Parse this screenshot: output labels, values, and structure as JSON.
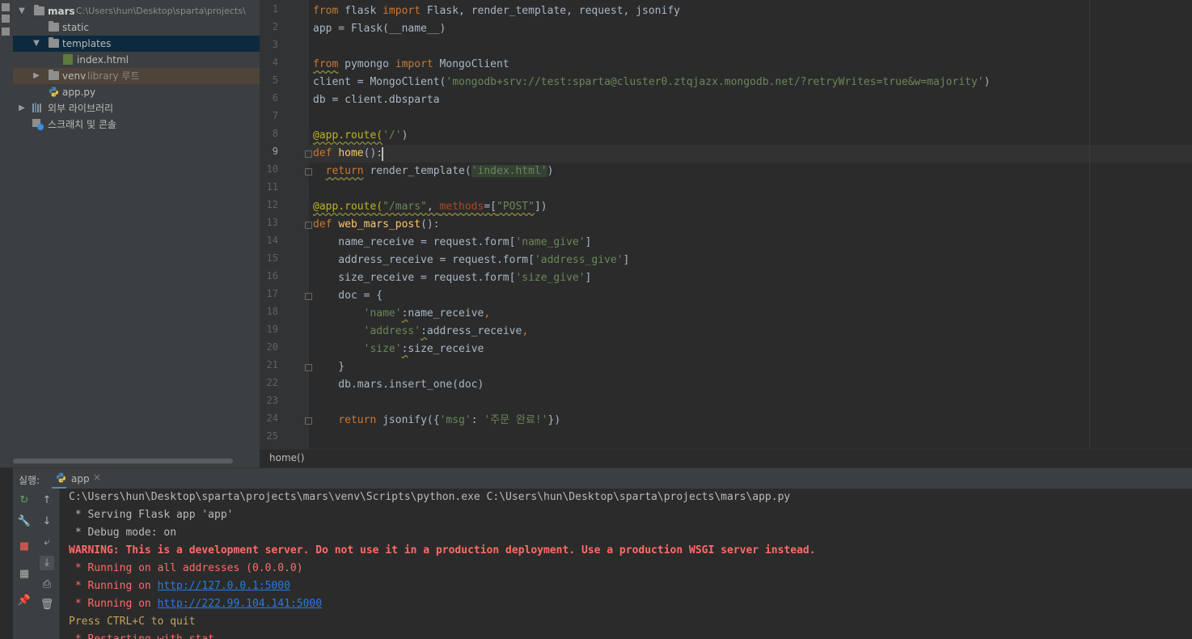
{
  "project": {
    "root_name": "mars",
    "root_path": "C:\\Users\\hun\\Desktop\\sparta\\projects\\",
    "items": [
      {
        "label": "static"
      },
      {
        "label": "templates"
      },
      {
        "label": "index.html"
      },
      {
        "label": "venv",
        "sub": "library 루트"
      },
      {
        "label": "app.py"
      },
      {
        "label": "외부 라이브러리"
      },
      {
        "label": "스크래치 및 콘솔"
      }
    ]
  },
  "editor": {
    "current_line": 9,
    "lines": [
      {
        "n": "1"
      },
      {
        "n": "2"
      },
      {
        "n": "3"
      },
      {
        "n": "4"
      },
      {
        "n": "5"
      },
      {
        "n": "6"
      },
      {
        "n": "7"
      },
      {
        "n": "8"
      },
      {
        "n": "9"
      },
      {
        "n": "10"
      },
      {
        "n": "11"
      },
      {
        "n": "12"
      },
      {
        "n": "13"
      },
      {
        "n": "14"
      },
      {
        "n": "15"
      },
      {
        "n": "16"
      },
      {
        "n": "17"
      },
      {
        "n": "18"
      },
      {
        "n": "19"
      },
      {
        "n": "20"
      },
      {
        "n": "21"
      },
      {
        "n": "22"
      },
      {
        "n": "23"
      },
      {
        "n": "24"
      },
      {
        "n": "25"
      }
    ],
    "code": {
      "l1": {
        "a": "from",
        "b": " flask ",
        "c": "import",
        "d": " Flask, render_template, request, jsonify"
      },
      "l2": "app = Flask(__name__)",
      "l4": {
        "a": "from",
        "b": " pymongo ",
        "c": "import",
        "d": " MongoClient"
      },
      "l5": {
        "a": "client = MongoClient(",
        "b": "'mongodb+srv://test:sparta@cluster0.ztqjazx.mongodb.net/?retryWrites=true&w=majority'",
        "c": ")"
      },
      "l6": "db = client.dbsparta",
      "l8": {
        "a": "@app.route(",
        "b": "'/'",
        "c": ")"
      },
      "l9": {
        "a": "def",
        "b": " ",
        "c": "home",
        "d": "():"
      },
      "l10": {
        "a": "return",
        "b": " render_template(",
        "c": "'index.html'",
        "d": ")"
      },
      "l12": {
        "a": "@app.route(",
        "b": "\"/mars\"",
        "c": ", ",
        "d": "methods",
        "e": "=[",
        "f": "\"POST\"",
        "g": "])"
      },
      "l13": {
        "a": "def",
        "b": " ",
        "c": "web_mars_post",
        "d": "():"
      },
      "l14": {
        "a": "    name_receive = request.form[",
        "b": "'name_give'",
        "c": "]"
      },
      "l15": {
        "a": "    address_receive = request.form[",
        "b": "'address_give'",
        "c": "]"
      },
      "l16": {
        "a": "    size_receive = request.form[",
        "b": "'size_give'",
        "c": "]"
      },
      "l17": "    doc = {",
      "l18": {
        "a": "        ",
        "b": "'name'",
        "c": ":",
        "d": "name_receive",
        "e": ","
      },
      "l19": {
        "a": "        ",
        "b": "'address'",
        "c": ":",
        "d": "address_receive",
        "e": ","
      },
      "l20": {
        "a": "        ",
        "b": "'size'",
        "c": ":",
        "d": "size_receive"
      },
      "l21": "    }",
      "l22": "    db.mars.insert_one(doc)",
      "l24": {
        "a": "    ",
        "b": "return",
        "c": " jsonify({",
        "d": "'msg'",
        "e": ": ",
        "f": "'주문 완료!'",
        "g": "})"
      }
    },
    "breadcrumb": "home()"
  },
  "run": {
    "title": "실행:",
    "tab_label": "app",
    "tab_close": "×",
    "console": {
      "l1": "C:\\Users\\hun\\Desktop\\sparta\\projects\\mars\\venv\\Scripts\\python.exe C:\\Users\\hun\\Desktop\\sparta\\projects\\mars\\app.py",
      "l2": " * Serving Flask app 'app'",
      "l3": " * Debug mode: on",
      "l4": "WARNING: This is a development server. Do not use it in a production deployment. Use a production WSGI server instead.",
      "l5": " * Running on all addresses (0.0.0.0)",
      "l6_prefix": " * Running on ",
      "l6_link": "http://127.0.0.1:5000",
      "l7_prefix": " * Running on ",
      "l7_link": "http://222.99.104.141:5000",
      "l8": "Press CTRL+C to quit",
      "l9": " * Restarting with stat"
    }
  },
  "colors": {
    "background": "#2b2b2b",
    "panel": "#3c3f41",
    "keyword": "#cc7832",
    "string": "#6a8759",
    "decorator": "#bbb529",
    "function": "#ffc66d",
    "error_text": "#ff6b68",
    "link": "#287bde"
  }
}
